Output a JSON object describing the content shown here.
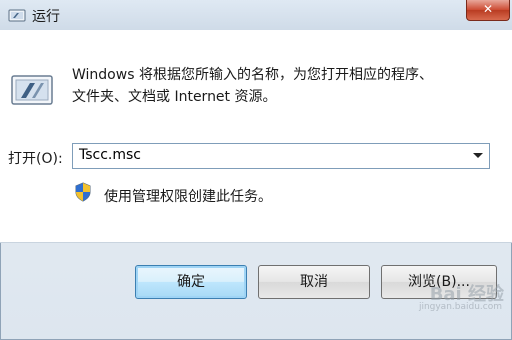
{
  "window": {
    "title": "运行",
    "close_symbol": "✕"
  },
  "dialog": {
    "description_line1": "Windows 将根据您所输入的名称，为您打开相应的程序、",
    "description_line2": "文件夹、文档或 Internet 资源。",
    "open_label": "打开(O):",
    "open_value": "Tscc.msc",
    "admin_note": "使用管理权限创建此任务。"
  },
  "buttons": {
    "ok": "确定",
    "cancel": "取消",
    "browse": "浏览(B)..."
  },
  "watermark": {
    "text": "Bai 经验",
    "sub": "jingyan.baidu.com"
  },
  "icons": {
    "title": "run-icon",
    "main": "run-icon",
    "shield": "uac-shield-icon",
    "dropdown": "chevron-down-icon"
  }
}
